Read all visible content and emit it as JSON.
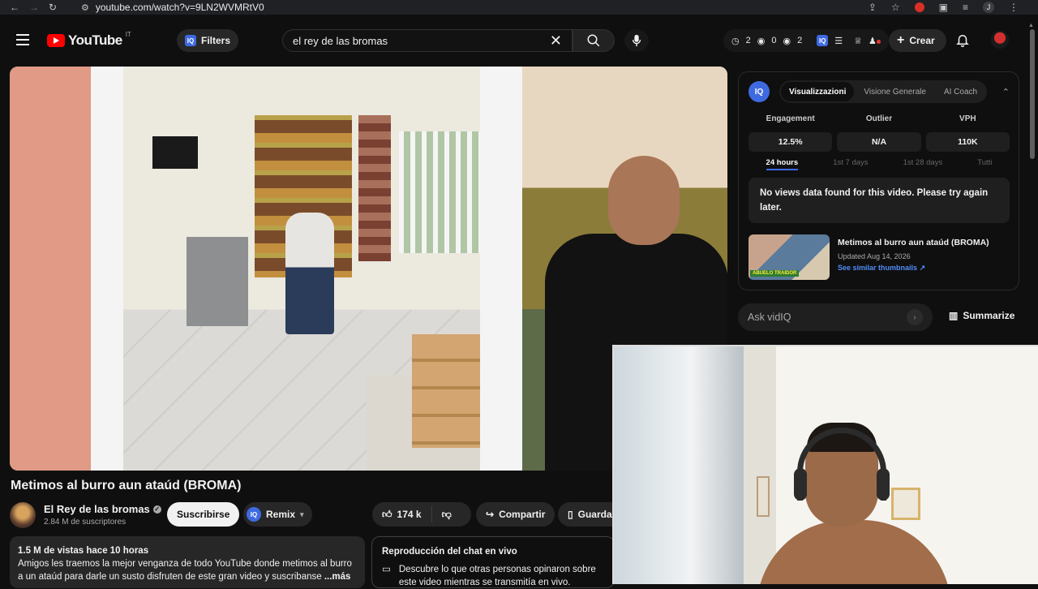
{
  "browser": {
    "url": "youtube.com/watch?v=9LN2WVMRtV0",
    "profile_initial": "J"
  },
  "header": {
    "logo_text": "YouTube",
    "country_code": "IT",
    "filters_label": "Filters",
    "search_query": "el rey de las bromas",
    "stats": {
      "a": "2",
      "b": "0",
      "c": "2"
    },
    "create_label": "Crear"
  },
  "video": {
    "title": "Metimos al burro aun ataúd (BROMA)",
    "channel_name": "El Rey de las bromas",
    "subscribers": "2.84 M de suscriptores",
    "subscribe_label": "Suscribirse",
    "remix_label": "Remix",
    "likes": "174 k",
    "share_label": "Compartir",
    "save_label": "Guardar"
  },
  "description": {
    "stats": "1.5 M de vistas  hace 10 horas",
    "text": "Amigos les traemos la mejor venganza de todo YouTube donde metimos al burro a un ataúd para darle un susto disfruten de este gran video y suscribanse",
    "more": "...más"
  },
  "live_chat": {
    "title": "Reproducción del chat en vivo",
    "text": "Descubre lo que otras personas opinaron sobre este video mientras se transmitía en vivo."
  },
  "vidiq": {
    "logo": "IQ",
    "tabs": [
      "Visualizzazioni",
      "Visione Generale",
      "AI Coach"
    ],
    "metrics": [
      {
        "label": "Engagement",
        "value": "12.5%"
      },
      {
        "label": "Outlier",
        "value": "N/A"
      },
      {
        "label": "VPH",
        "value": "110K"
      }
    ],
    "ranges": [
      "24 hours",
      "1st 7 days",
      "1st 28 days",
      "Tutti"
    ],
    "no_data": "No views data found for this video. Please try again later.",
    "similar": {
      "title": "Metimos al burro aun ataúd (BROMA)",
      "updated": "Updated Aug 14, 2026",
      "link": "See similar thumbnails",
      "thumb_tag": "ABUELO TRAIDOR"
    },
    "ask_placeholder": "Ask vidIQ",
    "summarize_label": "Summarize"
  },
  "colors": {
    "background": "#0f0f0f",
    "accent_red": "#ff0000",
    "vidiq_blue": "#3e6ae1"
  }
}
